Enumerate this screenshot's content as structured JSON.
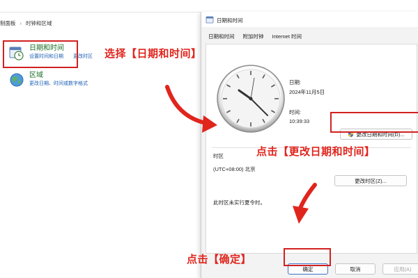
{
  "control_panel": {
    "breadcrumb": [
      "制面板",
      "时钟和区域"
    ],
    "datetime": {
      "title": "日期和时间",
      "links": [
        "设置时间和日期",
        "更改时区"
      ]
    },
    "region": {
      "title": "区域",
      "links": [
        "更改日期、时间或数字格式"
      ]
    }
  },
  "annotations": {
    "select_datetime": "选择【日期和时间】",
    "click_change_datetime": "点击【更改日期和时间】",
    "click_ok": "点击【确定】"
  },
  "dialog": {
    "title": "日期和时间",
    "tabs": [
      "日期和时间",
      "附加时钟",
      "Internet 时间"
    ],
    "date_label": "日期:",
    "date_value": "2024年11月5日",
    "time_label": "时间:",
    "time_value": "10:39:33",
    "change_datetime_button": "更改日期和时间(D)...",
    "timezone_label": "时区",
    "timezone_value": "(UTC+08:00) 北京",
    "change_timezone_button": "更改时区(Z)...",
    "dst_note": "此时区未实行夏令时。",
    "ok_button": "确定",
    "cancel_button": "取消",
    "apply_button": "应用(A)"
  },
  "colors": {
    "annotation_red": "#e0251d",
    "link_blue": "#1b5fb3",
    "title_green": "#1a6d23"
  }
}
